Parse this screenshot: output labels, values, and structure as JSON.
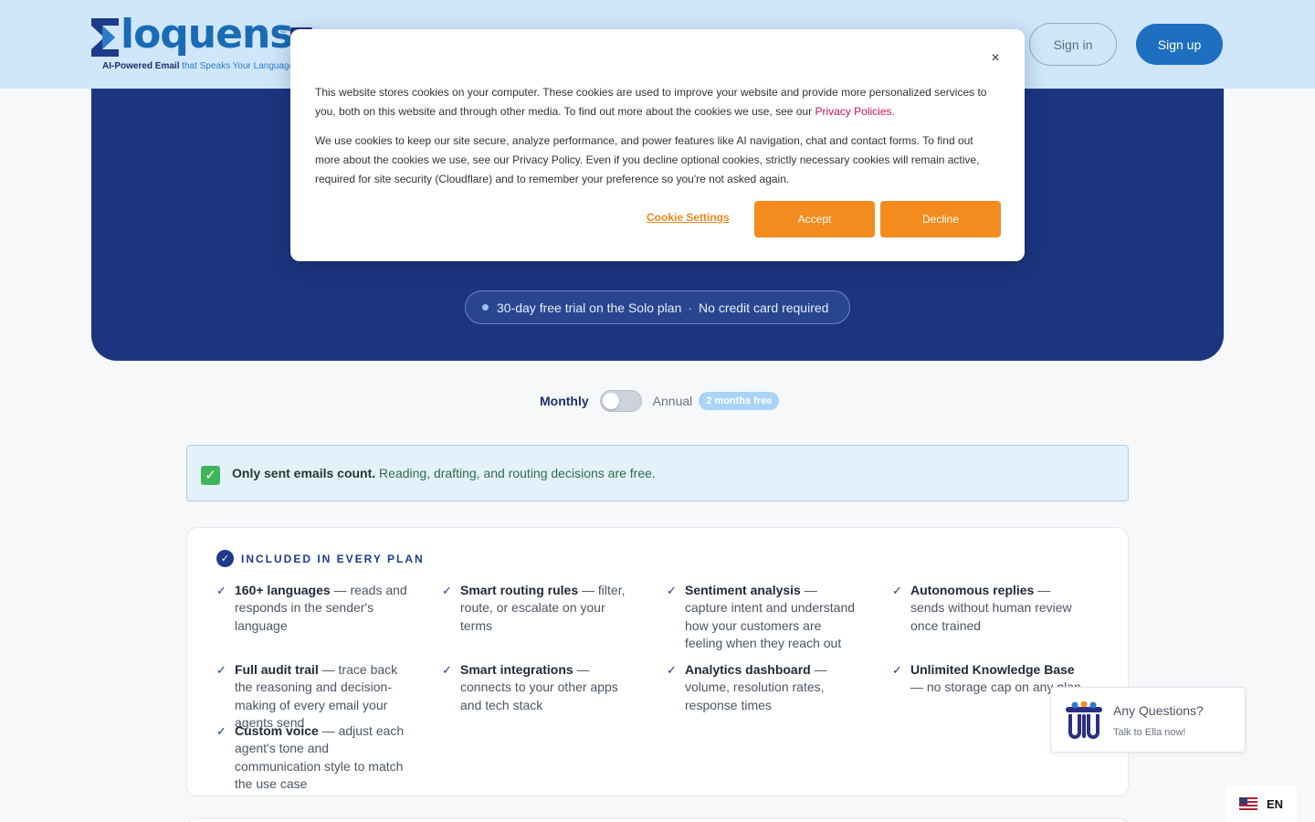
{
  "header": {
    "logo_text": "loquens",
    "logo_reg": "®",
    "tagline_bold": "AI-Powered Email",
    "tagline_rest": "that Speaks Your Language",
    "signin_label": "Sign in",
    "signup_label": "Sign up"
  },
  "hero": {
    "trial_text": "30-day free trial on the Solo plan",
    "trial_sep": "·",
    "trial_note": "No credit card required"
  },
  "billing": {
    "monthly_label": "Monthly",
    "annual_label": "Annual",
    "annual_badge": "2 months free",
    "annual_enabled": false
  },
  "notice": {
    "icon": "check-mark-icon",
    "bold": "Only sent emails count.",
    "rest": "Reading, drafting, and routing decisions are free."
  },
  "included": {
    "title": "INCLUDED IN EVERY PLAN",
    "features": [
      {
        "bold": "160+ languages",
        "rest": " — reads and responds in the sender's language"
      },
      {
        "bold": "Smart routing rules",
        "rest": " — filter, route, or escalate on your terms"
      },
      {
        "bold": "Sentiment analysis",
        "rest": " — capture intent and understand how your customers are feeling when they reach out"
      },
      {
        "bold": "Autonomous replies",
        "rest": " — sends without human review once trained"
      },
      {
        "bold": "Full audit trail",
        "rest": " — trace back the reasoning and decision-making of every email your agents send"
      },
      {
        "bold": "Smart integrations",
        "rest": " — connects to your other apps and tech stack"
      },
      {
        "bold": "Analytics dashboard",
        "rest": " — volume, resolution rates, response times"
      },
      {
        "bold": "Unlimited Knowledge Base",
        "rest": " — no storage cap on any plan"
      },
      {
        "bold": "Custom voice",
        "rest": " — adjust each agent's tone and communication style to match the use case"
      }
    ]
  },
  "cookie_banner": {
    "p1": "This website stores cookies on your computer. These cookies are used to improve your website and provide more personalized services to you, both on this website and through other media. To find out more about the cookies we use, see our",
    "privacy_link": "Privacy Policies.",
    "p2": "We use cookies to keep our site secure, analyze performance, and power features like AI navigation, chat and contact forms. To find out more about the cookies we use, see our Privacy Policy. Even if you decline optional cookies, strictly necessary cookies will remain active, required for site security (Cloudflare) and to remember your preference so you're not asked again.",
    "settings_label": "Cookie Settings",
    "accept_label": "Accept",
    "decline_label": "Decline",
    "close_glyph": "×"
  },
  "chat_widget": {
    "title": "Any Questions?",
    "subtitle": "Talk to Ella now!"
  },
  "language": {
    "code": "EN"
  },
  "colors": {
    "hero_bg": "#1b3580",
    "header_bg": "#cfe6fb",
    "primary": "#1e6fc0",
    "cookie_accent": "#f48b1f"
  }
}
